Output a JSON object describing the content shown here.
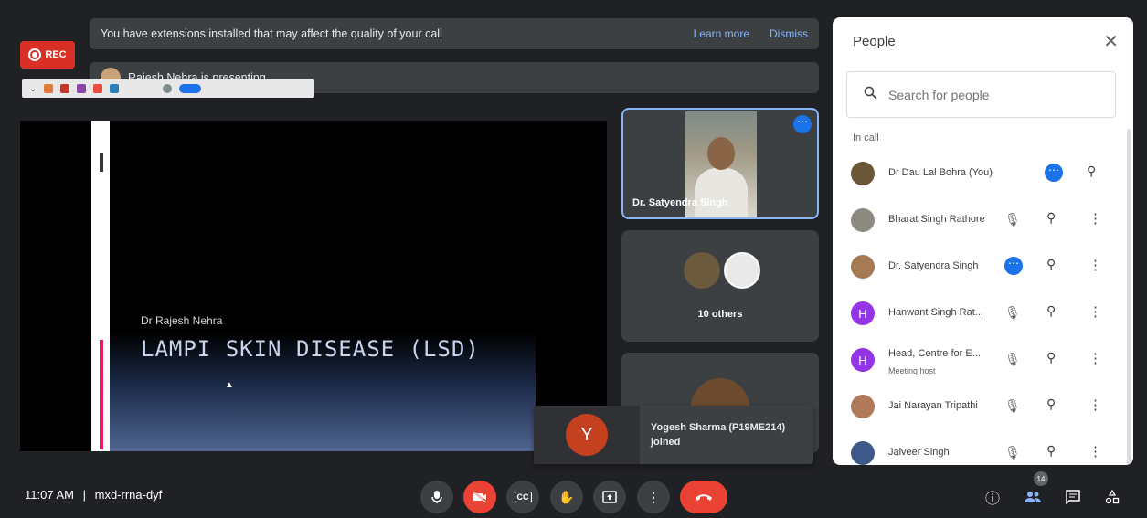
{
  "banner": {
    "message": "You have extensions installed that may affect the quality of your call",
    "learn_more": "Learn more",
    "dismiss": "Dismiss"
  },
  "recording": {
    "label": "REC"
  },
  "presenting": {
    "text": "Rajesh Nehra is presenting"
  },
  "slide": {
    "author": "Dr Rajesh Nehra",
    "title": "LAMPI SKIN DISEASE (LSD)"
  },
  "tiles": {
    "active_speaker": "Dr. Satyendra Singh",
    "others": "10 others"
  },
  "toast": {
    "initial": "Y",
    "line1": "Yogesh Sharma (P19ME214)",
    "line2": "joined"
  },
  "bottom": {
    "time": "11:07 AM",
    "separator": "|",
    "meeting_code": "mxd-rrna-dyf",
    "participant_count": "14"
  },
  "people_panel": {
    "title": "People",
    "search_placeholder": "Search for people",
    "section": "In call",
    "participants": [
      {
        "name": "Dr Dau Lal Bohra (You)",
        "subtitle": ""
      },
      {
        "name": "Bharat Singh Rathore",
        "subtitle": ""
      },
      {
        "name": "Dr. Satyendra Singh",
        "subtitle": ""
      },
      {
        "name": "Hanwant Singh Rat...",
        "subtitle": "",
        "initial": "H"
      },
      {
        "name": "Head, Centre for E...",
        "subtitle": "Meeting host",
        "initial": "H"
      },
      {
        "name": "Jai Narayan Tripathi",
        "subtitle": ""
      },
      {
        "name": "Jaiveer Singh",
        "subtitle": ""
      }
    ]
  },
  "colors": {
    "background": "#202124",
    "surface": "#3c4043",
    "accent": "#1a73e8",
    "end_call": "#ea4335",
    "link": "#8ab4f8",
    "avatar_purple": "#9334e6"
  }
}
